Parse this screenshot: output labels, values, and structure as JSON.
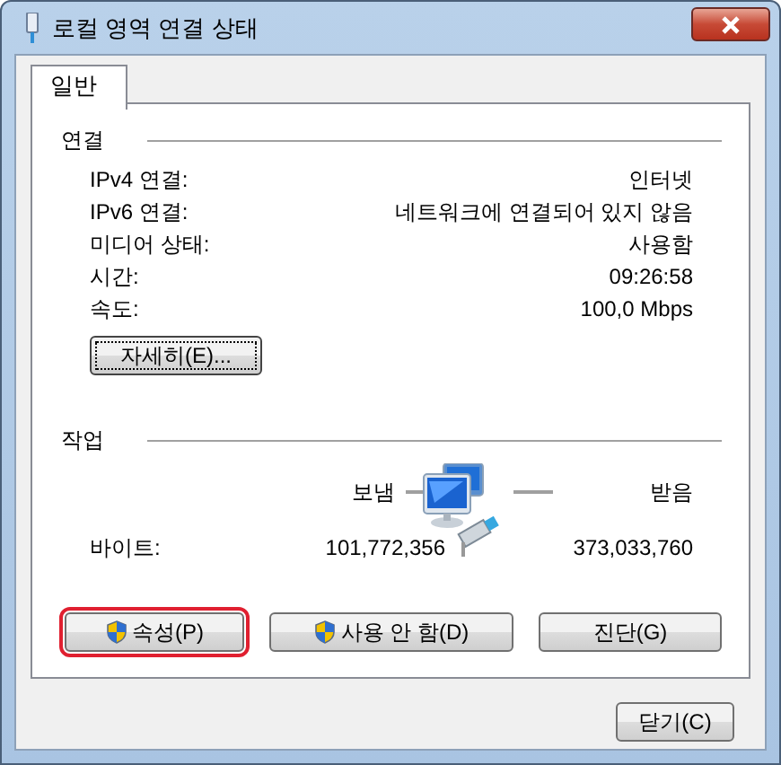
{
  "window": {
    "title": "로컬 영역 연결 상태"
  },
  "tabs": [
    {
      "label": "일반",
      "selected": true
    }
  ],
  "connection": {
    "heading": "연결",
    "rows": [
      {
        "label": "IPv4 연결:",
        "value": "인터넷"
      },
      {
        "label": "IPv6 연결:",
        "value": "네트워크에 연결되어 있지 않음"
      },
      {
        "label": "미디어 상태:",
        "value": "사용함"
      },
      {
        "label": "시간:",
        "value": "09:26:58"
      },
      {
        "label": "속도:",
        "value": "100,0 Mbps"
      }
    ],
    "details_button": "자세히(E)..."
  },
  "activity": {
    "heading": "작업",
    "sent_label": "보냄",
    "received_label": "받음",
    "bytes_label": "바이트:",
    "bytes_sent": "101,772,356",
    "bytes_received": "373,033,760"
  },
  "buttons": [
    {
      "label": "속성(P)",
      "shield": true,
      "highlighted": true
    },
    {
      "label": "사용 안 함(D)",
      "shield": true,
      "highlighted": false
    },
    {
      "label": "진단(G)",
      "shield": false,
      "highlighted": false
    }
  ],
  "close_button": "닫기(C)"
}
